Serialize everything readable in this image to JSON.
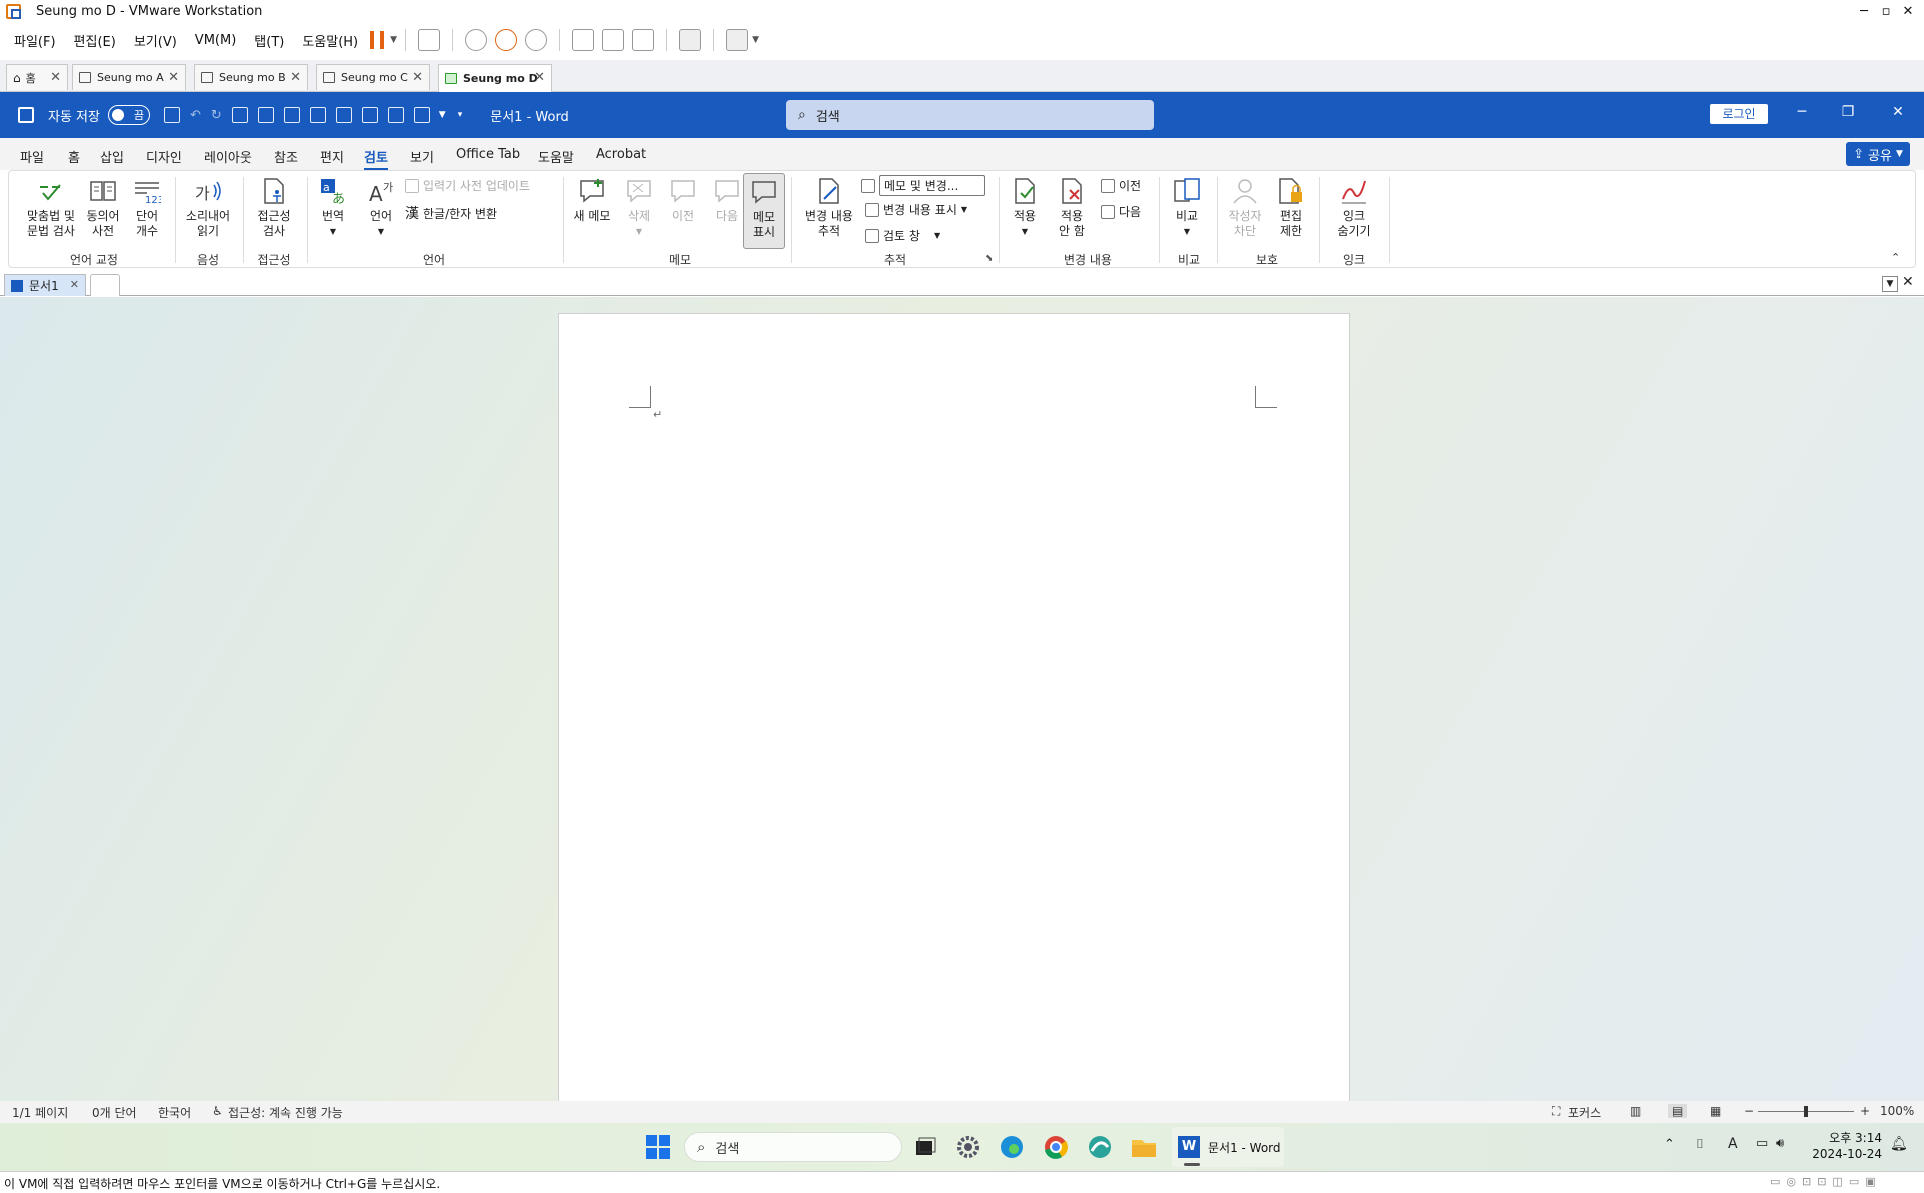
{
  "vm": {
    "title": "Seung mo D - VMware Workstation",
    "menu": [
      "파일(F)",
      "편집(E)",
      "보기(V)",
      "VM(M)",
      "탭(T)",
      "도움말(H)"
    ],
    "tabs": [
      "홈",
      "Seung mo A",
      "Seung mo B",
      "Seung mo C",
      "Seung mo D"
    ],
    "status_message": "이 VM에 직접 입력하려면 마우스 포인터를 VM으로 이동하거나 Ctrl+G를 누르십시오."
  },
  "word": {
    "autosave_label": "자동 저장",
    "autosave_state": "끔",
    "doc_title": "문서1 - Word",
    "search_placeholder": "검색",
    "login_label": "로그인",
    "share_label": "공유",
    "ribbon_tabs": [
      "파일",
      "홈",
      "삽입",
      "디자인",
      "레이아웃",
      "참조",
      "편지",
      "검토",
      "보기",
      "Office Tab",
      "도움말",
      "Acrobat"
    ],
    "active_tab": "검토",
    "ribbon": {
      "spelling": "맞춤법 및|문법 검사",
      "thesaurus": "동의어|사전",
      "wordcount": "단어|개수",
      "readaloud": "소리내어|읽기",
      "accessibility": "접근성|검사",
      "translate": "번역",
      "language": "언어",
      "ime_update": "입력기 사전 업데이트",
      "hanja": "한글/한자 변환",
      "new_comment": "새 메모",
      "delete": "삭제",
      "previous": "이전",
      "next": "다음",
      "show_comments": "메모|표시",
      "track_changes": "변경 내용|추적",
      "markup_select": "메모 및 변경...",
      "show_markup": "변경 내용 표시",
      "review_pane": "검토 창",
      "accept": "적용",
      "reject": "적용|안 함",
      "change_prev": "이전",
      "change_next": "다음",
      "compare": "비교",
      "block_authors": "작성자|차단",
      "restrict_editing": "편집|제한",
      "hide_ink": "잉크|숨기기",
      "groups": [
        "언어 교정",
        "음성",
        "접근성",
        "언어",
        "메모",
        "추적",
        "변경 내용",
        "비교",
        "보호",
        "잉크"
      ]
    },
    "doc_tab": "문서1",
    "status": {
      "page": "1/1 페이지",
      "words": "0개 단어",
      "language": "한국어",
      "accessibility": "접근성: 계속 진행 가능",
      "focus": "포커스",
      "zoom": "100%"
    }
  },
  "taskbar": {
    "search_placeholder": "검색",
    "word_app": "문서1 - Word",
    "time": "오후 3:14",
    "date": "2024-10-24",
    "ime": "A"
  },
  "colors": {
    "word_blue": "#185abd",
    "pause_orange": "#e2620f"
  }
}
